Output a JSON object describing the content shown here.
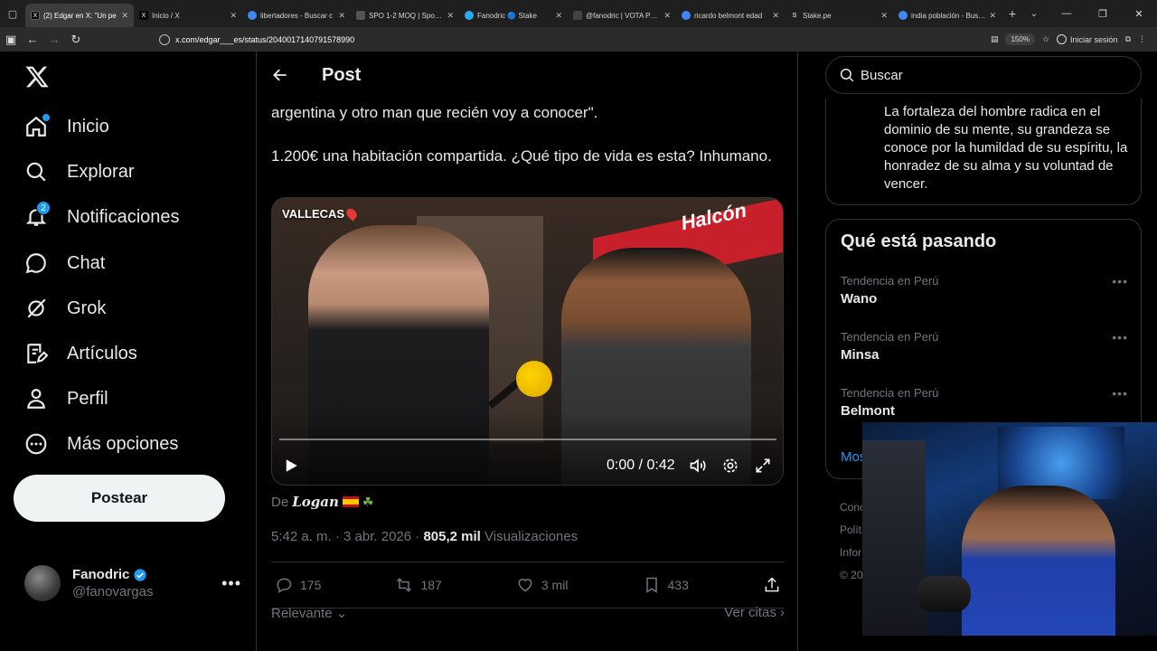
{
  "browser": {
    "tabs": [
      {
        "title": "(2) Edgar en X: \"Un pe",
        "favicon_color": "#000000",
        "favicon_glyph": "X",
        "active": true
      },
      {
        "title": "Inicio / X",
        "favicon_color": "#000000",
        "favicon_glyph": "X",
        "active": false
      },
      {
        "title": "libertadores - Buscar c",
        "favicon_color": "#4285f4",
        "favicon_glyph": "",
        "active": false
      },
      {
        "title": "SPO 1-2 MOQ | Sportin",
        "favicon_color": "#333333",
        "favicon_glyph": "",
        "active": false
      },
      {
        "title": "Fanodric 🔵 Stake",
        "favicon_color": "#2aabee",
        "favicon_glyph": "",
        "active": false
      },
      {
        "title": "@fanodric | VOTA POR",
        "favicon_color": "#444444",
        "favicon_glyph": "",
        "active": false
      },
      {
        "title": "ricardo belmont edad",
        "favicon_color": "#4285f4",
        "favicon_glyph": "",
        "active": false
      },
      {
        "title": "Stake.pe",
        "favicon_color": "#1f1f1f",
        "favicon_glyph": "S",
        "active": false
      },
      {
        "title": "india población - Busca",
        "favicon_color": "#4285f4",
        "favicon_glyph": "",
        "active": false
      }
    ],
    "url": "x.com/edgar___es/status/2040017140791578990",
    "zoom": "150%",
    "signin_label": "Iniciar sesión"
  },
  "nav": {
    "items": [
      {
        "label": "Inicio",
        "icon": "home-icon",
        "dot": true
      },
      {
        "label": "Explorar",
        "icon": "search-icon"
      },
      {
        "label": "Notificaciones",
        "icon": "bell-icon",
        "badge": "2"
      },
      {
        "label": "Chat",
        "icon": "chat-icon"
      },
      {
        "label": "Grok",
        "icon": "grok-icon"
      },
      {
        "label": "Artículos",
        "icon": "articles-icon"
      },
      {
        "label": "Perfil",
        "icon": "person-icon"
      },
      {
        "label": "Más opciones",
        "icon": "more-circle-icon"
      }
    ],
    "post_button": "Postear",
    "account": {
      "name": "Fanodric",
      "handle": "@fanovargas"
    }
  },
  "post": {
    "header_title": "Post",
    "text_line1": "argentina y otro man que recién voy a conocer\".",
    "text_line2": "1.200€ una habitación compartida. ¿Qué tipo de vida es esta? Inhumano.",
    "video": {
      "location_label": "VALLECAS",
      "banner_text": "Halcón",
      "time": "0:00 / 0:42",
      "progress": 0
    },
    "source_prefix": "De",
    "source_name": "Logan",
    "timestamp": "5:42 a. m. · 3 abr. 2026 · ",
    "views_count": "805,2 mil",
    "views_label": "Visualizaciones",
    "replies": "175",
    "reposts": "187",
    "likes": "3 mil",
    "bookmarks": "433",
    "sort_label": "Relevante",
    "quotes_label": "Ver citas"
  },
  "sidebar": {
    "search_placeholder": "Buscar",
    "quote_text": "La fortaleza del hombre radica en el dominio de su mente, su grandeza se conoce por la humildad de su espíritu, la honradez de su alma y su voluntad de vencer.",
    "trends_title": "Qué está pasando",
    "trends": [
      {
        "context": "Tendencia en Perú",
        "name": "Wano"
      },
      {
        "context": "Tendencia en Perú",
        "name": "Minsa"
      },
      {
        "context": "Tendencia en Perú",
        "name": "Belmont"
      }
    ],
    "show_more": "Mos",
    "footer": [
      "Conc",
      "Polít",
      "Infor",
      "© 20"
    ]
  },
  "colors": {
    "accent": "#1d9bf0",
    "bg": "#000000",
    "border": "#2f3336",
    "muted": "#71767b"
  }
}
